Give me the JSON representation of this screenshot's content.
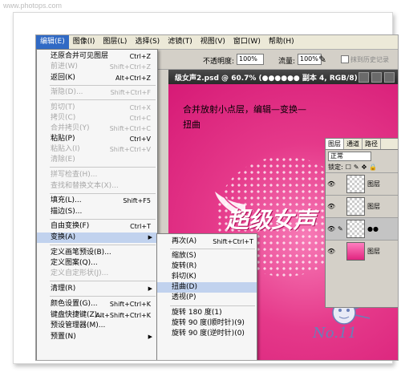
{
  "watermark": "www.photops.com",
  "menubar": [
    "编辑(E)",
    "图像(I)",
    "图层(L)",
    "选择(S)",
    "滤镜(T)",
    "视图(V)",
    "窗口(W)",
    "帮助(H)"
  ],
  "options": {
    "opacity_label": "不透明度:",
    "opacity_value": "100%",
    "flow_label": "流量:",
    "flow_value": "100%",
    "history_label": "抹到历史记录"
  },
  "document": {
    "title": "级女声2.psd @ 60.7% (●●●●●● 副本 4, RGB/8)",
    "note_line1": "合并放射小点层，编辑—变换—",
    "note_line2": "扭曲",
    "logo_text": "超级女声",
    "signature": "No.11"
  },
  "layers_panel": {
    "tabs": [
      "图层",
      "通道",
      "路径"
    ],
    "blend_mode": "正常",
    "lock_label": "锁定:",
    "layer_names": [
      "图层",
      "图层",
      "图层",
      "图层"
    ]
  },
  "edit_menu": [
    {
      "label": "还原合并可见图层",
      "shortcut": "Ctrl+Z",
      "disabled": false
    },
    {
      "label": "前进(W)",
      "shortcut": "Shift+Ctrl+Z",
      "disabled": true
    },
    {
      "label": "返回(K)",
      "shortcut": "Alt+Ctrl+Z",
      "disabled": false
    },
    {
      "label": "渐隐(D)...",
      "shortcut": "Shift+Ctrl+F",
      "disabled": true
    },
    {
      "label": "剪切(T)",
      "shortcut": "Ctrl+X",
      "disabled": true
    },
    {
      "label": "拷贝(C)",
      "shortcut": "Ctrl+C",
      "disabled": true
    },
    {
      "label": "合并拷贝(Y)",
      "shortcut": "Shift+Ctrl+C",
      "disabled": true
    },
    {
      "label": "粘贴(P)",
      "shortcut": "Ctrl+V",
      "disabled": false
    },
    {
      "label": "粘贴入(I)",
      "shortcut": "Shift+Ctrl+V",
      "disabled": true
    },
    {
      "label": "清除(E)",
      "shortcut": "",
      "disabled": true
    },
    {
      "label": "拼写检查(H)...",
      "shortcut": "",
      "disabled": true
    },
    {
      "label": "查找和替换文本(X)...",
      "shortcut": "",
      "disabled": true
    },
    {
      "label": "填充(L)...",
      "shortcut": "Shift+F5",
      "disabled": false
    },
    {
      "label": "描边(S)...",
      "shortcut": "",
      "disabled": false
    },
    {
      "label": "自由变换(F)",
      "shortcut": "Ctrl+T",
      "disabled": false
    },
    {
      "label": "变换(A)",
      "shortcut": "",
      "disabled": false
    },
    {
      "label": "定义画笔预设(B)...",
      "shortcut": "",
      "disabled": false
    },
    {
      "label": "定义图案(Q)...",
      "shortcut": "",
      "disabled": false
    },
    {
      "label": "定义自定形状(J)...",
      "shortcut": "",
      "disabled": true
    },
    {
      "label": "清理(R)",
      "shortcut": "",
      "disabled": false
    },
    {
      "label": "颜色设置(G)...",
      "shortcut": "Shift+Ctrl+K",
      "disabled": false
    },
    {
      "label": "键盘快捷键(Z)...",
      "shortcut": "Alt+Shift+Ctrl+K",
      "disabled": false
    },
    {
      "label": "预设管理器(M)...",
      "shortcut": "",
      "disabled": false
    },
    {
      "label": "预置(N)",
      "shortcut": "",
      "disabled": false
    }
  ],
  "transform_submenu": [
    {
      "label": "再次(A)",
      "shortcut": "Shift+Ctrl+T"
    },
    {
      "label": "缩放(S)",
      "shortcut": ""
    },
    {
      "label": "旋转(R)",
      "shortcut": ""
    },
    {
      "label": "斜切(K)",
      "shortcut": ""
    },
    {
      "label": "扭曲(D)",
      "shortcut": ""
    },
    {
      "label": "透视(P)",
      "shortcut": ""
    },
    {
      "label": "旋转 180 度(1)",
      "shortcut": ""
    },
    {
      "label": "旋转 90 度(顺时针)(9)",
      "shortcut": ""
    },
    {
      "label": "旋转 90 度(逆时针)(0)",
      "shortcut": ""
    }
  ]
}
